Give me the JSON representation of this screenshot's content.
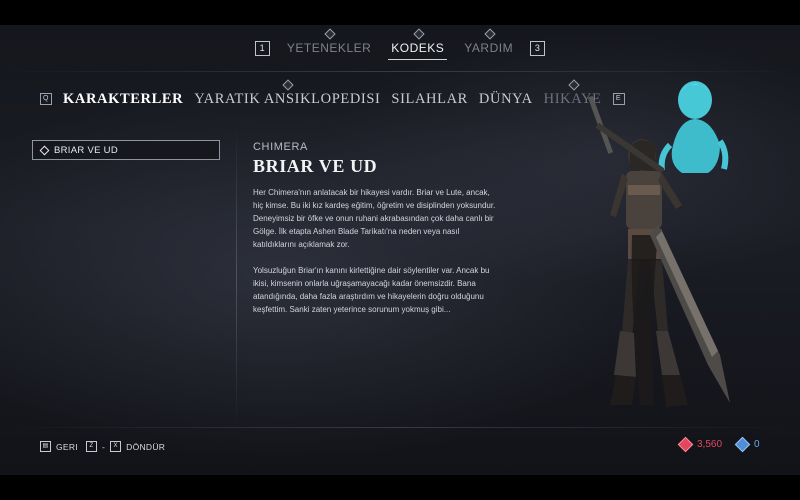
{
  "top_nav": {
    "left_key": "1",
    "right_key": "3",
    "items": [
      {
        "label": "YETENEKLER",
        "active": false
      },
      {
        "label": "KODEKS",
        "active": true
      },
      {
        "label": "YARDIM",
        "active": false
      }
    ]
  },
  "category_tabs": {
    "left_key": "Q",
    "right_key": "E",
    "items": [
      {
        "label": "KARAKTERLER",
        "active": true
      },
      {
        "label": "YARATIK ANSIKLOPEDISI",
        "active": false
      },
      {
        "label": "SILAHLAR",
        "active": false
      },
      {
        "label": "DÜNYA",
        "active": false
      },
      {
        "label": "HIKAYE",
        "active": false
      }
    ]
  },
  "entry_list": {
    "items": [
      {
        "label": "BRIAR VE UD",
        "selected": true
      }
    ]
  },
  "entry": {
    "category": "CHIMERA",
    "title": "BRIAR VE UD",
    "paragraphs": [
      "Her Chimera'nın anlatacak bir hikayesi vardır. Briar ve Lute, ancak, hiç kimse. Bu iki kız kardeş eğitim, öğretim ve disiplinden yoksundur. Deneyimsiz bir öfke ve onun ruhani akrabasından çok daha canlı bir Gölge. İlk etapta Ashen Blade Tarikatı'na neden veya nasıl katıldıklarını açıklamak zor.",
      "Yolsuzluğun Briar'ın kanını kirlettiğine dair söylentiler var. Ancak bu ikisi, kimsenin onlarla uğraşamayacağı kadar önemsizdir. Bana atandığında, daha fazla araştırdım ve hikayelerin doğru olduğunu keşfettim. Sanki zaten yeterince sorunum yokmuş gibi..."
    ]
  },
  "footer": {
    "back_label": "GERI",
    "rotate_key_left": "Z",
    "rotate_key_right": "X",
    "rotate_label": "DÖNDÜR",
    "currency_primary": "3,560",
    "currency_secondary": "0",
    "currency_primary_color": "#e0485e",
    "currency_secondary_color": "#4f8fd8"
  }
}
